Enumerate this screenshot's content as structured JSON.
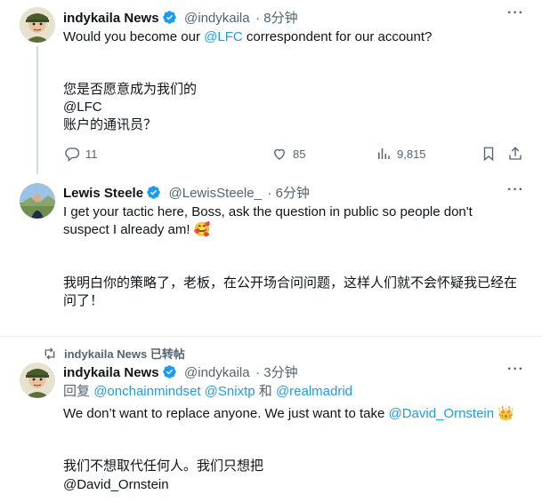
{
  "tweet1": {
    "name": "indykaila News",
    "handle": "@indykaila",
    "time": "· 8分钟",
    "line1_pre": "Would you become our ",
    "line1_mention": "@LFC",
    "line1_post": " correspondent for our account?",
    "cn1": "您是否愿意成为我们的",
    "cn2": "@LFC",
    "cn3": " 账户的通讯员？",
    "replies": "11",
    "likes": "85",
    "views": "9,815"
  },
  "tweet2": {
    "name": "Lewis Steele",
    "handle": "@LewisSteele_",
    "time": "· 6分钟",
    "line1": "I get your tactic here, Boss, ask the question in public so people don't",
    "line2": "suspect I already am!",
    "emoji": "🥰",
    "cn1": "我明白你的策略了，老板，在公开场合问问题，这样人们就不会怀疑我已经在",
    "cn2": "问了！"
  },
  "retweet_banner": "indykaila News 已转帖",
  "tweet3": {
    "name": "indykaila News",
    "handle": "@indykaila",
    "time": "· 3分钟",
    "reply_label": "回复",
    "reply_m1": "@onchainmindset",
    "reply_m2": "@Snixtp",
    "reply_and": "和",
    "reply_m3": "@realmadrid",
    "line1_pre": "We don’t want to replace anyone. We just want to take ",
    "line1_mention": "@David_Ornstein",
    "crown": "👑",
    "cn1": "我们不想取代任何人。我们只想把",
    "cn2": "@David_Ornstein"
  },
  "icons": {
    "more": "more-icon",
    "reply": "reply-icon",
    "like": "heart-icon",
    "views": "views-icon",
    "bookmark": "bookmark-icon",
    "share": "share-icon",
    "retweet": "retweet-icon",
    "verified": "verified-badge-icon"
  },
  "colors": {
    "accent": "#1d9bf0",
    "muted": "#536471",
    "divider": "#eff3f4"
  }
}
